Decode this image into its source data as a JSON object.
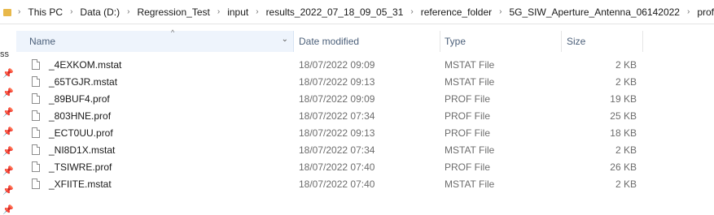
{
  "breadcrumb": {
    "items": [
      "This PC",
      "Data (D:)",
      "Regression_Test",
      "input",
      "results_2022_07_18_09_05_31",
      "reference_folder",
      "5G_SIW_Aperture_Antenna_06142022",
      "prof"
    ],
    "separator": "›"
  },
  "nav": {
    "partial_label": "ss"
  },
  "columns": {
    "name": "Name",
    "date": "Date modified",
    "type": "Type",
    "size": "Size",
    "sort_glyph": "^",
    "chevron_glyph": "⌄"
  },
  "files": [
    {
      "name": "_4EXKOM.mstat",
      "date": "18/07/2022 09:09",
      "type": "MSTAT File",
      "size": "2 KB"
    },
    {
      "name": "_65TGJR.mstat",
      "date": "18/07/2022 09:13",
      "type": "MSTAT File",
      "size": "2 KB"
    },
    {
      "name": "_89BUF4.prof",
      "date": "18/07/2022 09:09",
      "type": "PROF File",
      "size": "19 KB"
    },
    {
      "name": "_803HNE.prof",
      "date": "18/07/2022 07:34",
      "type": "PROF File",
      "size": "25 KB"
    },
    {
      "name": "_ECT0UU.prof",
      "date": "18/07/2022 09:13",
      "type": "PROF File",
      "size": "18 KB"
    },
    {
      "name": "_NI8D1X.mstat",
      "date": "18/07/2022 07:34",
      "type": "MSTAT File",
      "size": "2 KB"
    },
    {
      "name": "_TSIWRE.prof",
      "date": "18/07/2022 07:40",
      "type": "PROF File",
      "size": "26 KB"
    },
    {
      "name": "_XFIITE.mstat",
      "date": "18/07/2022 07:40",
      "type": "MSTAT File",
      "size": "2 KB"
    }
  ],
  "icons": {
    "pin": "📌",
    "folder": "folder-icon"
  }
}
